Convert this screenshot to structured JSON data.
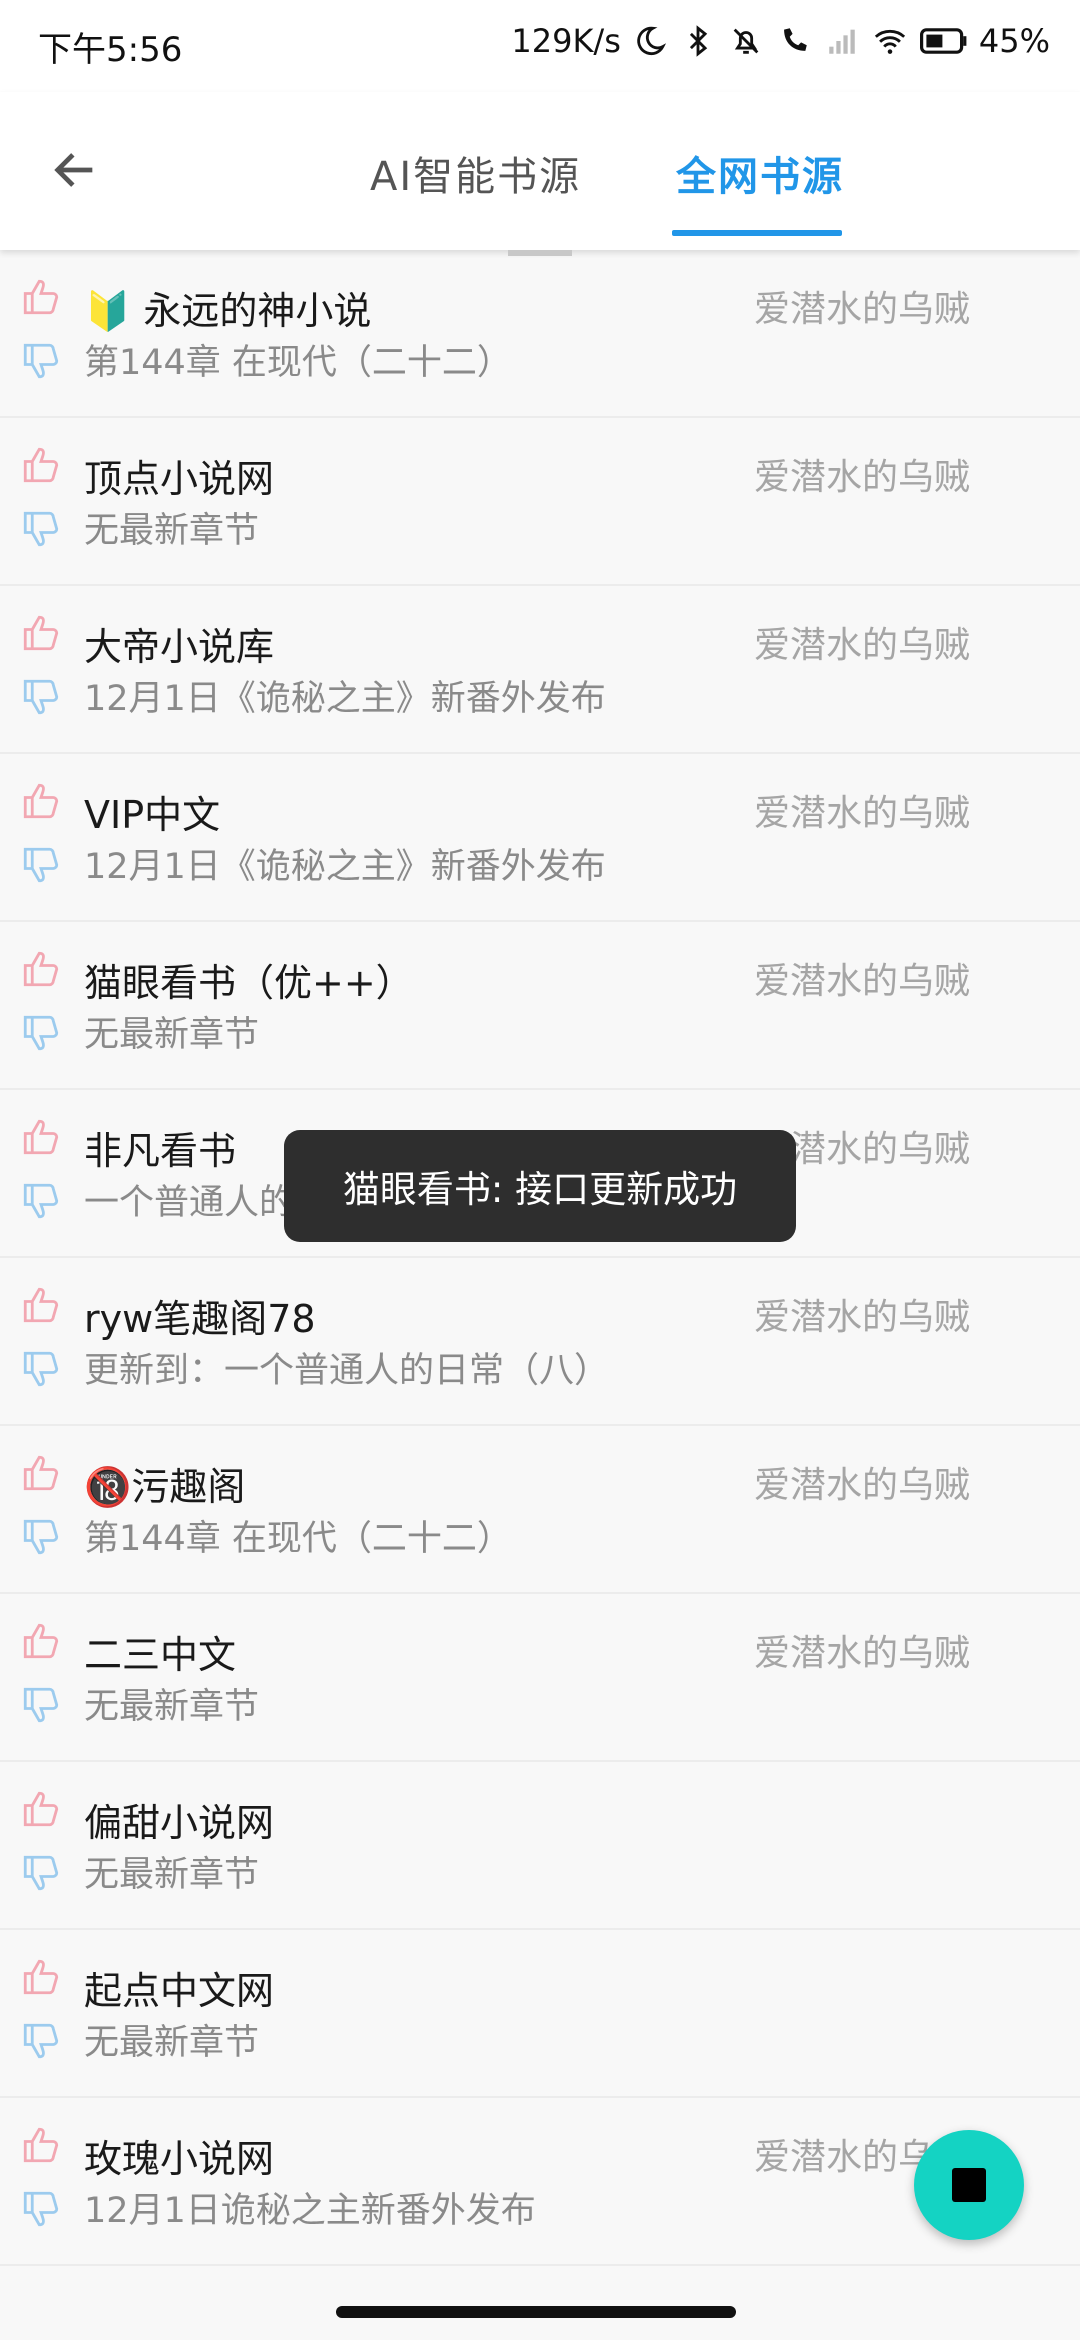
{
  "status_bar": {
    "time": "下午5:56",
    "net_speed": "129K/s",
    "battery": "45%"
  },
  "header": {
    "tabs": [
      {
        "label": "AI智能书源",
        "active": false
      },
      {
        "label": "全网书源",
        "active": true
      }
    ],
    "accent_color": "#2196e8"
  },
  "sources": [
    {
      "name": "🔰 永远的神小说",
      "latest": "第144章 在现代（二十二）",
      "author": "爱潜水的乌贼"
    },
    {
      "name": "顶点小说网",
      "latest": "无最新章节",
      "author": "爱潜水的乌贼"
    },
    {
      "name": "大帝小说库",
      "latest": "12月1日《诡秘之主》新番外发布",
      "author": "爱潜水的乌贼"
    },
    {
      "name": "VIP中文",
      "latest": "12月1日《诡秘之主》新番外发布",
      "author": "爱潜水的乌贼"
    },
    {
      "name": "猫眼看书（优++）",
      "latest": "无最新章节",
      "author": "爱潜水的乌贼"
    },
    {
      "name": "非凡看书",
      "latest": "一个普通人的日常（八）",
      "author": "爱潜水的乌贼"
    },
    {
      "name": "ryw笔趣阁78",
      "latest": "更新到：一个普通人的日常（八）",
      "author": "爱潜水的乌贼"
    },
    {
      "name": "🔞污趣阁",
      "latest": "第144章 在现代（二十二）",
      "author": "爱潜水的乌贼"
    },
    {
      "name": "二三中文",
      "latest": "无最新章节",
      "author": "爱潜水的乌贼"
    },
    {
      "name": "偏甜小说网",
      "latest": "无最新章节",
      "author": ""
    },
    {
      "name": "起点中文网",
      "latest": "无最新章节",
      "author": ""
    },
    {
      "name": "玫瑰小说网",
      "latest": "12月1日诡秘之主新番外发布",
      "author": "爱潜水的乌贼"
    }
  ],
  "toast": {
    "message": "猫眼看书: 接口更新成功"
  },
  "fab": {
    "icon": "stop-icon",
    "color": "#14d3c3"
  }
}
